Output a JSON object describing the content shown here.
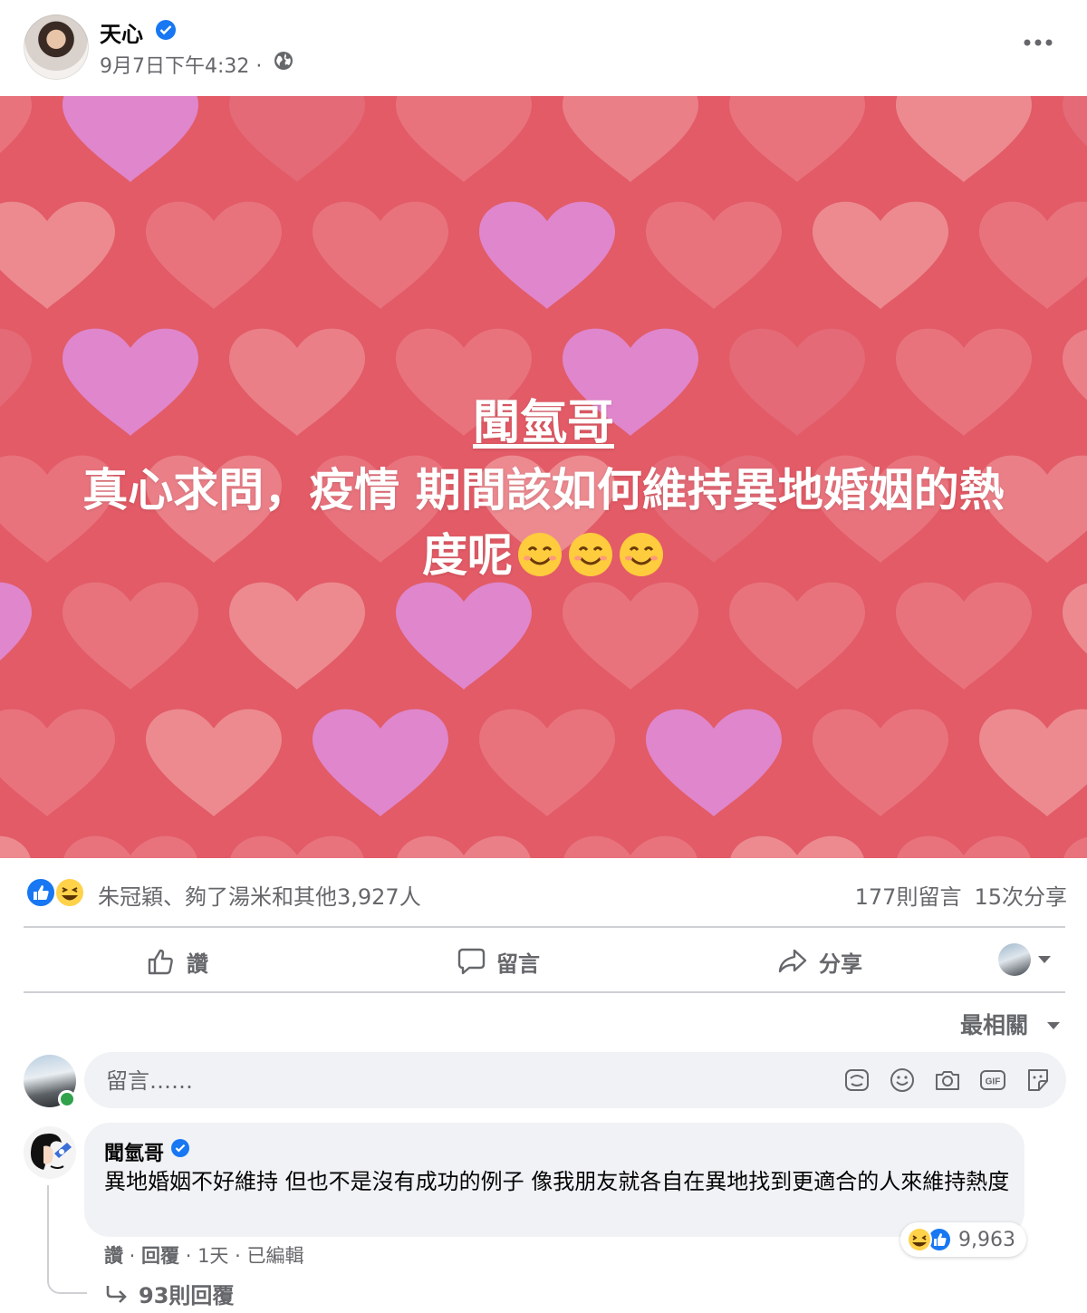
{
  "post": {
    "author": "天心",
    "time": "9月7日下午4:32 ·",
    "mention": "聞氫哥",
    "text_line1": "真心求問，疫情  期間該如何維持異地婚姻的熱",
    "text_line2": "度呢"
  },
  "stats": {
    "reactions_text": "朱冠穎、夠了湯米和其他3,927人",
    "comments": "177則留言",
    "shares": "15次分享"
  },
  "actions": {
    "like": "讚",
    "comment": "留言",
    "share": "分享"
  },
  "sort_label": "最相關",
  "composer": {
    "placeholder": "留言……"
  },
  "comment": {
    "name": "聞氫哥",
    "text": "異地婚姻不好維持 但也不是沒有成功的例子 像我朋友就各自在異地找到更適合的人來維持熱度",
    "reaction_count": "9,963",
    "like_label": "讚",
    "reply_label": "回覆",
    "age": "1天",
    "edited": "已編輯",
    "replies": "93則回覆"
  },
  "colors": {
    "brand": "#1877f2",
    "banner": "#e25b66",
    "muted_text": "#65676b"
  }
}
